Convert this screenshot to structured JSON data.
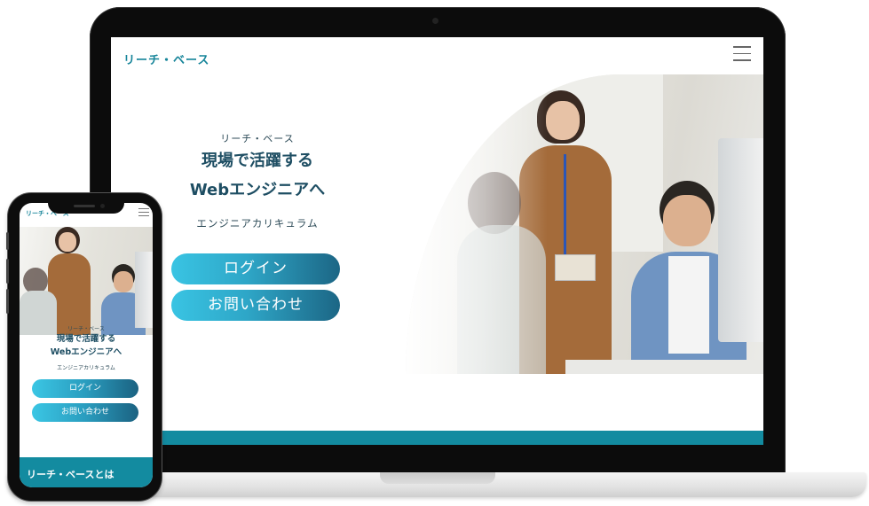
{
  "desktop": {
    "logo": "リーチ・ベース",
    "hero": {
      "subtitle": "リーチ・ベース",
      "title_line1": "現場で活躍する",
      "title_line2": "Webエンジニアへ",
      "curriculum": "エンジニアカリキュラム"
    },
    "buttons": {
      "login": "ログイン",
      "contact": "お問い合わせ"
    },
    "colors": {
      "brand": "#17859a",
      "band": "#138ba0",
      "button_start": "#39c4e3",
      "button_end": "#1c6685"
    }
  },
  "mobile": {
    "logo": "リーチ・ベース",
    "hero": {
      "subtitle": "リーチ・ベース",
      "title_line1": "現場で活躍する",
      "title_line2": "Webエンジニアへ",
      "curriculum": "エンジニアカリキュラム"
    },
    "buttons": {
      "login": "ログイン",
      "contact": "お問い合わせ"
    },
    "section_heading": "リーチ・ベースとは"
  },
  "icons": [
    "hamburger-menu-icon"
  ]
}
